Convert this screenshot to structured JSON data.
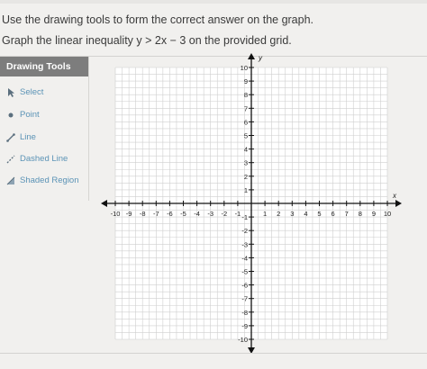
{
  "question": {
    "instruction": "Use the drawing tools to form the correct answer on the graph.",
    "prompt_prefix": "Graph the linear inequality ",
    "prompt_math": "y > 2x − 3",
    "prompt_suffix": " on the provided grid."
  },
  "drawing_tools": {
    "title": "Drawing Tools",
    "items": [
      {
        "label": "Select",
        "icon": "cursor-icon"
      },
      {
        "label": "Point",
        "icon": "point-icon"
      },
      {
        "label": "Line",
        "icon": "line-icon"
      },
      {
        "label": "Dashed Line",
        "icon": "dashed-line-icon"
      },
      {
        "label": "Shaded Region",
        "icon": "shaded-region-icon"
      }
    ]
  },
  "graph": {
    "x_axis_label": "x",
    "y_axis_label": "y",
    "x_range": [
      -10,
      10
    ],
    "y_range": [
      -10,
      10
    ],
    "minor_step": 0.5,
    "major_step": 1,
    "colors": {
      "grid": "#cfcfcf",
      "axis": "#111111",
      "background": "#ffffff"
    }
  }
}
